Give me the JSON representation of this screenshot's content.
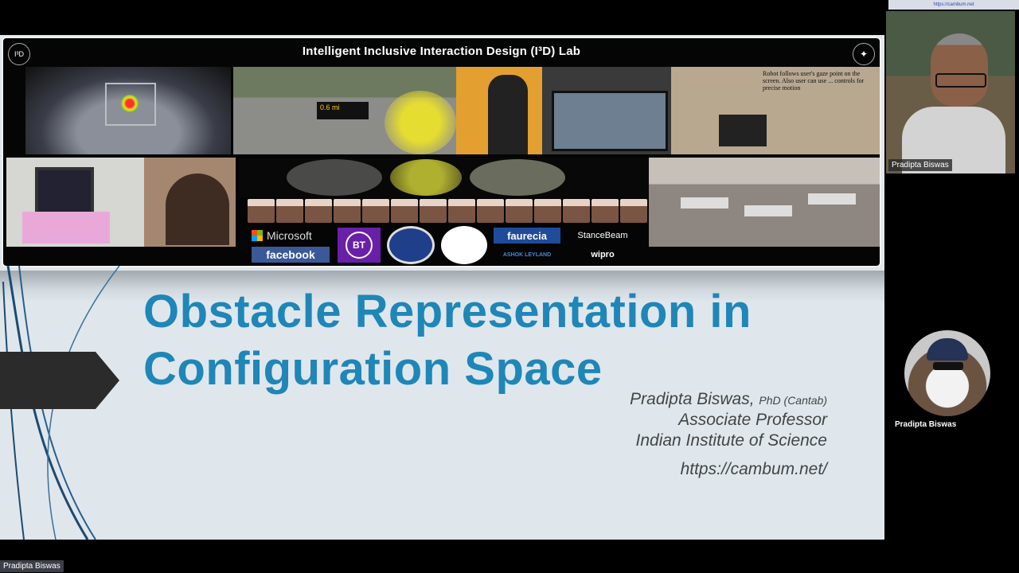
{
  "banner": {
    "title": "Intelligent Inclusive Interaction Design (I³D) Lab",
    "left_logo": "I³D",
    "robot_note": "Robot follows user's gaze point on the screen. Also user can use ... controls for precise motion",
    "road_sign": "0.6 mi",
    "sponsors": {
      "microsoft": "Microsoft",
      "facebook": "facebook",
      "bt": "BT",
      "faurecia": "faurecia",
      "ashok_leyland": "ASHOK LEYLAND",
      "stancebeam": "StanceBeam",
      "wipro": "wipro"
    }
  },
  "slide": {
    "title_line1": "Obstacle Representation in",
    "title_line2": "Configuration Space",
    "author_name": "Pradipta Biswas,",
    "author_degree": "PhD (Cantab)",
    "author_title": "Associate Professor",
    "author_org": "Indian Institute of Science",
    "author_url": "https://cambum.net/"
  },
  "participants": {
    "top_video_label": "Pradipta Biswas",
    "avatar_label": "Pradipta Biswas",
    "bottom_label": "Pradipta Biswas"
  },
  "colors": {
    "title": "#1f86b8",
    "background": "#000000",
    "slide_bg": "#dfe7ec"
  }
}
